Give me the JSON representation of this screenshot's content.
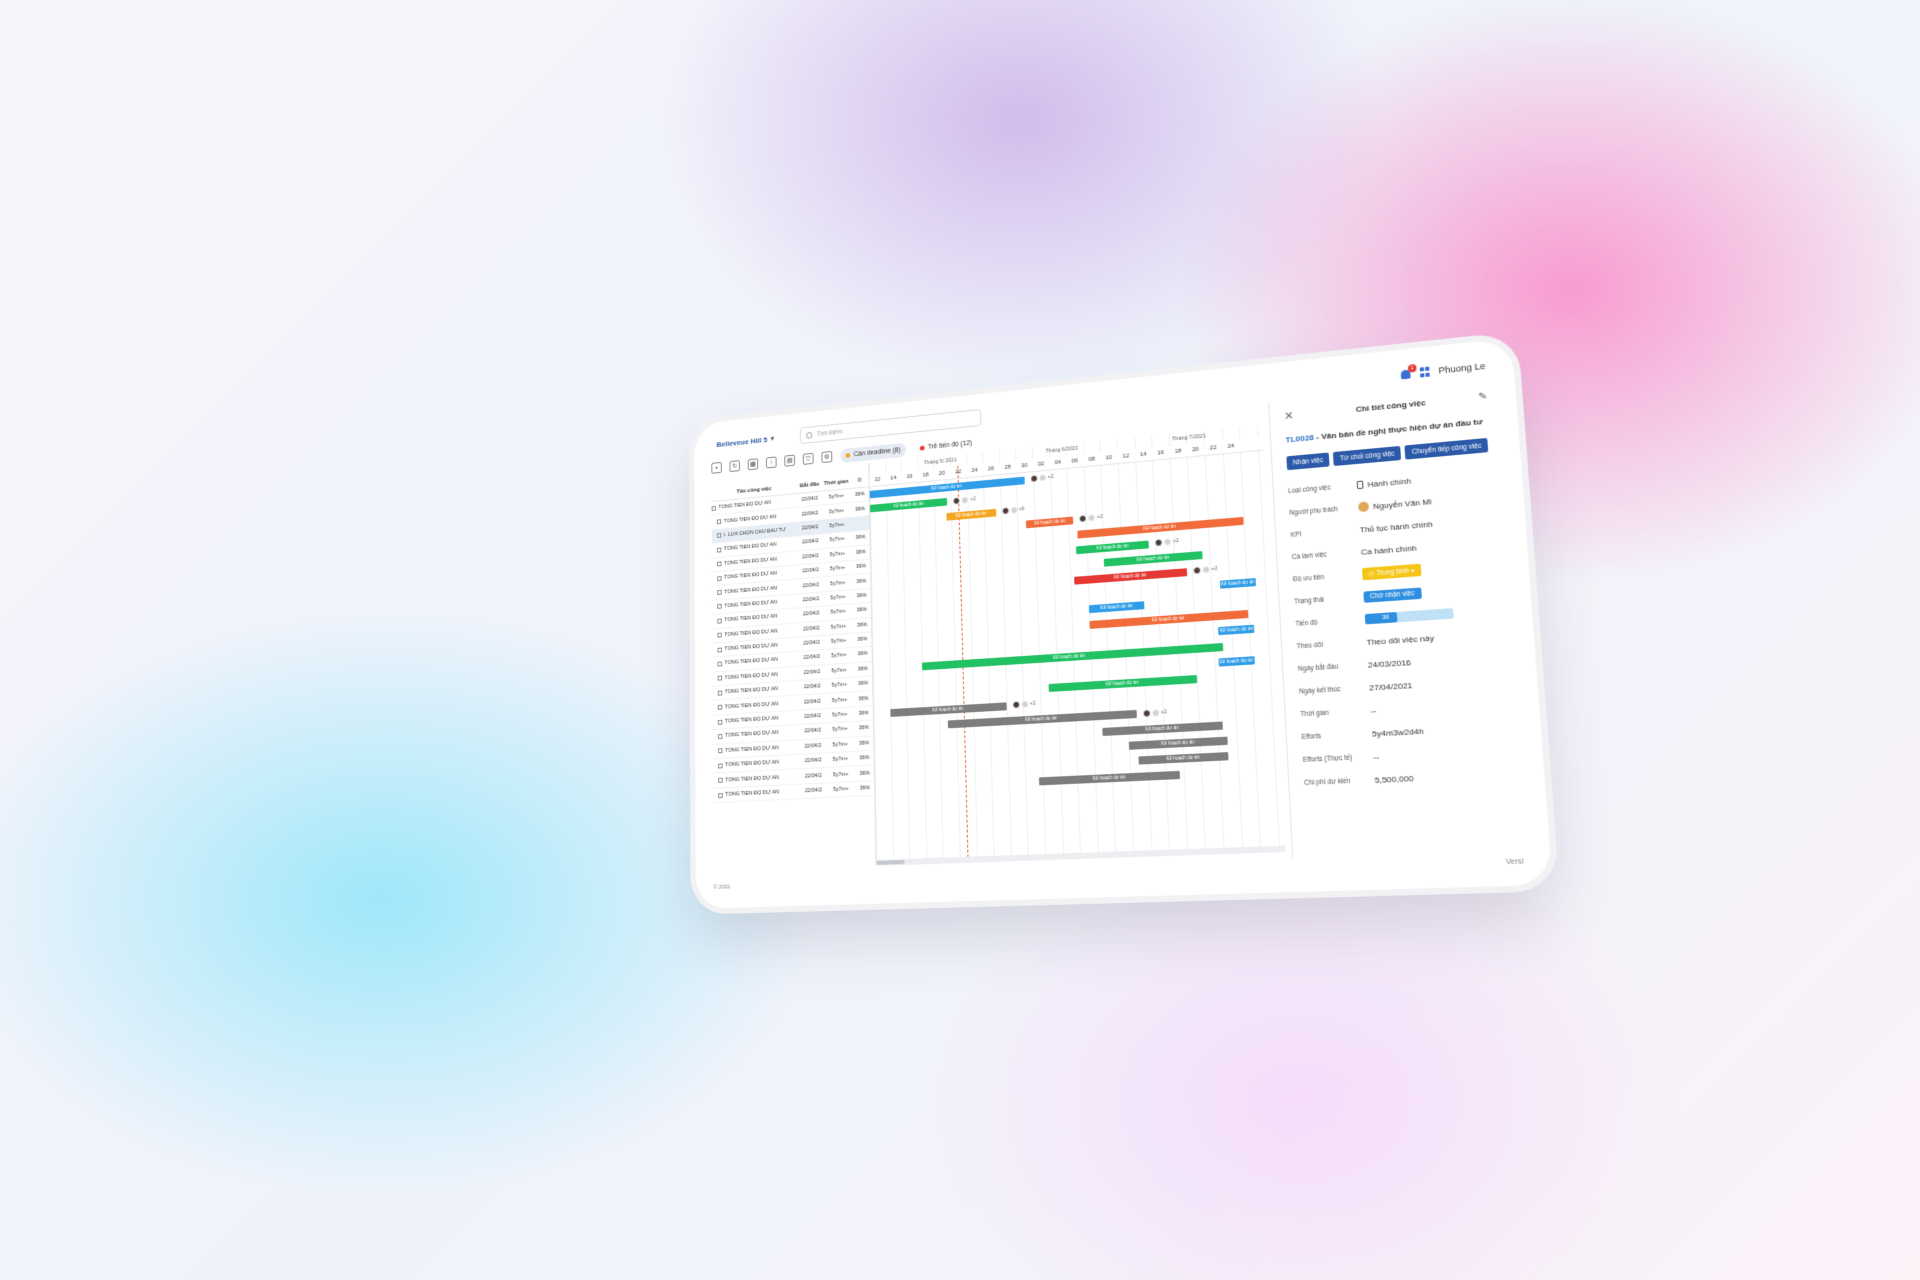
{
  "header": {
    "project": "Belleveue Hill 5",
    "search_placeholder": "Tìm kiếm",
    "notif_count": "1",
    "user": "Phuong Le"
  },
  "toolbar": {
    "chip_deadline": "Cận deadline (8)",
    "chip_late": "Trễ tiến độ (12)"
  },
  "table": {
    "col_name": "Tên công việc",
    "col_start": "Bắt đầu",
    "col_time": "Thời gian",
    "rows": [
      {
        "name": "TỔNG TIẾN ĐỘ DỰ ÁN",
        "start": "22/04/2",
        "time": "5y7m+",
        "pct": "36%"
      },
      {
        "name": "TỔNG TIẾN ĐỘ DỰ ÁN",
        "start": "22/04/2",
        "time": "5y7m+",
        "pct": "36%"
      },
      {
        "name": "I. LỰA CHỌN CHỦ ĐẦU TƯ",
        "start": "22/04/2",
        "time": "5y7m+",
        "pct": ""
      },
      {
        "name": "TỔNG TIẾN ĐỘ DỰ ÁN",
        "start": "22/04/2",
        "time": "5y7m+",
        "pct": "36%"
      },
      {
        "name": "TỔNG TIẾN ĐỘ DỰ ÁN",
        "start": "22/04/2",
        "time": "5y7m+",
        "pct": "36%"
      },
      {
        "name": "TỔNG TIẾN ĐỘ DỰ ÁN",
        "start": "22/04/2",
        "time": "5y7m+",
        "pct": "36%"
      },
      {
        "name": "TỔNG TIẾN ĐỘ DỰ ÁN",
        "start": "22/04/2",
        "time": "5y7m+",
        "pct": "36%"
      },
      {
        "name": "TỔNG TIẾN ĐỘ DỰ ÁN",
        "start": "22/04/2",
        "time": "5y7m+",
        "pct": "36%"
      },
      {
        "name": "TỔNG TIẾN ĐỘ DỰ ÁN",
        "start": "22/04/2",
        "time": "5y7m+",
        "pct": "36%"
      },
      {
        "name": "TỔNG TIẾN ĐỘ DỰ ÁN",
        "start": "22/04/2",
        "time": "5y7m+",
        "pct": "36%"
      },
      {
        "name": "TỔNG TIẾN ĐỘ DỰ ÁN",
        "start": "22/04/2",
        "time": "5y7m+",
        "pct": "36%"
      },
      {
        "name": "TỔNG TIẾN ĐỘ DỰ ÁN",
        "start": "22/04/2",
        "time": "5y7m+",
        "pct": "36%"
      },
      {
        "name": "TỔNG TIẾN ĐỘ DỰ ÁN",
        "start": "22/04/2",
        "time": "5y7m+",
        "pct": "36%"
      },
      {
        "name": "TỔNG TIẾN ĐỘ DỰ ÁN",
        "start": "22/04/2",
        "time": "5y7m+",
        "pct": "36%"
      },
      {
        "name": "TỔNG TIẾN ĐỘ DỰ ÁN",
        "start": "22/04/2",
        "time": "5y7m+",
        "pct": "36%"
      },
      {
        "name": "TỔNG TIẾN ĐỘ DỰ ÁN",
        "start": "22/04/2",
        "time": "5y7m+",
        "pct": "36%"
      },
      {
        "name": "TỔNG TIẾN ĐỘ DỰ ÁN",
        "start": "22/04/2",
        "time": "5y7m+",
        "pct": "36%"
      },
      {
        "name": "TỔNG TIẾN ĐỘ DỰ ÁN",
        "start": "22/04/2",
        "time": "5y7m+",
        "pct": "36%"
      },
      {
        "name": "TỔNG TIẾN ĐỘ DỰ ÁN",
        "start": "22/04/2",
        "time": "5y7m+",
        "pct": "36%"
      },
      {
        "name": "TỔNG TIẾN ĐỘ DỰ ÁN",
        "start": "22/04/2",
        "time": "5y7m+",
        "pct": "36%"
      },
      {
        "name": "TỔNG TIẾN ĐỘ DỰ ÁN",
        "start": "22/04/2",
        "time": "5y7m+",
        "pct": "36%"
      }
    ]
  },
  "gantt": {
    "months": [
      "Tháng 5/ 2021",
      "Tháng 6/2021",
      "Tháng 7/2021"
    ],
    "days": [
      "12",
      "14",
      "16",
      "18",
      "20",
      "22",
      "24",
      "26",
      "28",
      "30",
      "02",
      "04",
      "06",
      "08",
      "10",
      "12",
      "14",
      "16",
      "18",
      "20",
      "22",
      "24"
    ],
    "bar_label": "Kế hoạch dự án",
    "more": "+2",
    "more6": "+6",
    "bars": [
      {
        "row": 0,
        "start": 0,
        "len": 9.5,
        "color": "#2f9de8"
      },
      {
        "row": 1,
        "start": 0,
        "len": 4.8,
        "color": "#22c164"
      },
      {
        "row": 2,
        "start": 4.7,
        "len": 3.0,
        "color": "#f5a623"
      },
      {
        "row": 3,
        "start": 9.5,
        "len": 2.8,
        "color": "#f26b3a"
      },
      {
        "row": 4,
        "start": 12.5,
        "len": 9.5,
        "color": "#f26b3a"
      },
      {
        "row": 5,
        "start": 12.4,
        "len": 4.2,
        "color": "#22c164"
      },
      {
        "row": 6,
        "start": 14.0,
        "len": 5.6,
        "color": "#22c164"
      },
      {
        "row": 7,
        "start": 12.2,
        "len": 6.5,
        "color": "#e53935"
      },
      {
        "row": 8,
        "start": 20.5,
        "len": 2.0,
        "color": "#2f9de8"
      },
      {
        "row": 9,
        "start": 13.0,
        "len": 3.2,
        "color": "#2f9de8"
      },
      {
        "row": 10,
        "start": 13.0,
        "len": 9.0,
        "color": "#f26b3a"
      },
      {
        "row": 11,
        "start": 20.3,
        "len": 2.0,
        "color": "#2f9de8"
      },
      {
        "row": 12,
        "start": 3.0,
        "len": 17.5,
        "color": "#22c164"
      },
      {
        "row": 13,
        "start": 20.2,
        "len": 2.0,
        "color": "#2f9de8"
      },
      {
        "row": 14,
        "start": 10.5,
        "len": 8.5,
        "color": "#22c164"
      },
      {
        "row": 15,
        "start": 1.0,
        "len": 7.0,
        "color": "#7d7d7d"
      },
      {
        "row": 16,
        "start": 4.5,
        "len": 11.0,
        "color": "#7d7d7d"
      },
      {
        "row": 17,
        "start": 13.5,
        "len": 6.8,
        "color": "#7d7d7d"
      },
      {
        "row": 18,
        "start": 15.0,
        "len": 5.5,
        "color": "#7d7d7d"
      },
      {
        "row": 19,
        "start": 15.5,
        "len": 5.0,
        "color": "#7d7d7d"
      },
      {
        "row": 20,
        "start": 9.8,
        "len": 8.0,
        "color": "#7d7d7d"
      }
    ]
  },
  "panel": {
    "title": "Chi tiết công việc",
    "task_code": "TL0028",
    "task_name": " - Văn bản đề nghị thực hiện dự án đầu tư",
    "btn_accept": "Nhận việc",
    "btn_reject": "Từ chối công việc",
    "btn_forward": "Chuyển tiếp công việc",
    "fields": {
      "type_label": "Loại công việc",
      "type": "Hành chính",
      "owner_label": "Người phụ trách",
      "owner": "Nguyễn Văn Mi",
      "kpi_label": "KPI",
      "kpi": "Thủ tục hành chính",
      "shift_label": "Ca làm việc",
      "shift": "Ca hành chính",
      "priority_label": "Độ ưu tiên",
      "priority": "Trung bình",
      "status_label": "Trạng thái",
      "status": "Chờ nhận việc",
      "progress_label": "Tiến độ",
      "progress": "36",
      "progress_value": 0.36,
      "follow_label": "Theo dõi",
      "follow": "Theo dõi việc này",
      "start_label": "Ngày bắt đầu",
      "start": "24/03/2016",
      "end_label": "Ngày kết thúc",
      "end": "27/04/2021",
      "time_label": "Thời gian",
      "time": "--",
      "efforts_label": "Efforts",
      "efforts": "5y4m3w2d4h",
      "efforts_actual_label": "Efforts (Thực tế)",
      "efforts_actual": "--",
      "cost_label": "Chi phí dự kiến",
      "cost": "5,500,000"
    }
  },
  "footer": {
    "copyright": "© 2021",
    "version": "Versi"
  },
  "colors": {
    "brand": "#2c5aa8",
    "accent": "#2f8fe0",
    "today_line": "#e8603c"
  }
}
